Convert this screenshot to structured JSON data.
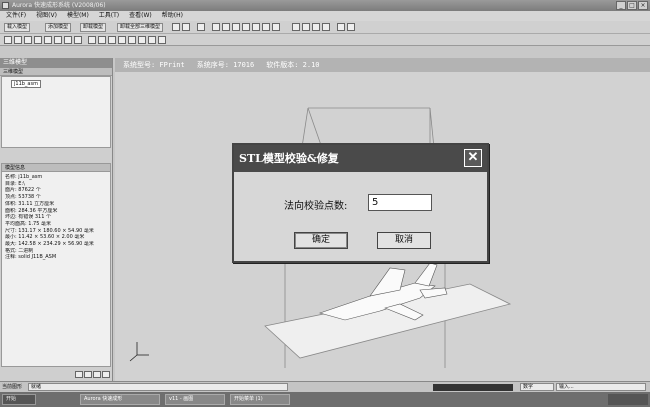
{
  "window": {
    "title": "Aurora 快速成形系统 (V2008/06)"
  },
  "menu": [
    "文件(F)",
    "视图(V)",
    "模型(M)",
    "工具(T)",
    "查看(W)",
    "帮助(H)"
  ],
  "toolbar": {
    "open_label": "载入模型",
    "add_label": "添加模型",
    "remove_label": "卸载模型",
    "remove_all_label": "卸载全部三维模型"
  },
  "left_panel": {
    "title": "三维模型",
    "tree_tab": "三维模型",
    "tree_item": "j11b_asm",
    "info_tab": "模型信息",
    "info_lines": [
      "名称: j11b_asm",
      "目录: E:\\",
      "面片: 87622 个",
      "顶点: 53738 个",
      "体积: 31.11 立方厘米",
      "面积: 284.36 平方厘米",
      "坏边: 有错误 311 个",
      "平均面高: 1.75 毫米",
      "尺寸: 131.17 × 180.60 × 54.90 毫米",
      "最小: 11.42 × 53.60 × 2.00 毫米",
      "最大: 142.58 × 234.29 × 56.90 毫米",
      "格式: 二进制",
      "注释: solid J11B_ASM"
    ]
  },
  "system_info": {
    "model": "系统型号: FPrint",
    "serial": "系统序号: 17016",
    "version": "软件版本: 2.10"
  },
  "dialog": {
    "title": "STL模型校验&修复",
    "label": "法向校验点数:",
    "value": "5",
    "ok_label": "确定",
    "cancel_label": "取消"
  },
  "statusbar": {
    "left": "当前图形",
    "mode": "就绪",
    "num": "数字",
    "input": "输入..."
  },
  "taskbar": {
    "start": "开始",
    "tasks": [
      "Aurora 快速成形",
      "v11 - 画图",
      "开始菜单 (1)"
    ]
  }
}
